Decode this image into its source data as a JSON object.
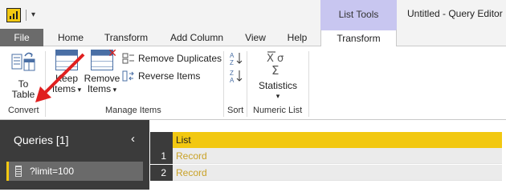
{
  "window": {
    "title": "Untitled - Query Editor",
    "context_tab_group": "List Tools"
  },
  "tabs": [
    {
      "label": "File"
    },
    {
      "label": "Home"
    },
    {
      "label": "Transform"
    },
    {
      "label": "Add Column"
    },
    {
      "label": "View"
    },
    {
      "label": "Help"
    },
    {
      "label": "Transform"
    }
  ],
  "ribbon": {
    "convert": {
      "group_label": "Convert",
      "to_table": {
        "line1": "To",
        "line2": "Table"
      }
    },
    "manage_items": {
      "group_label": "Manage Items",
      "keep_items": {
        "line1": "Keep",
        "line2": "Items"
      },
      "remove_items": {
        "line1": "Remove",
        "line2": "Items"
      },
      "remove_duplicates": "Remove Duplicates",
      "reverse_items": "Reverse Items"
    },
    "sort": {
      "group_label": "Sort"
    },
    "numeric_list": {
      "group_label": "Numeric List",
      "statistics": "Statistics"
    }
  },
  "queries_pane": {
    "title": "Queries [1]",
    "items": [
      {
        "label": "?limit=100"
      }
    ]
  },
  "grid": {
    "column_header": "List",
    "rows": [
      {
        "num": "1",
        "value": "Record"
      },
      {
        "num": "2",
        "value": "Record"
      }
    ]
  },
  "colors": {
    "accent_yellow": "#f2c811",
    "context_tab": "#c8c6f0",
    "dark_pane": "#3b3b3b",
    "annotation_arrow": "#e02020"
  }
}
